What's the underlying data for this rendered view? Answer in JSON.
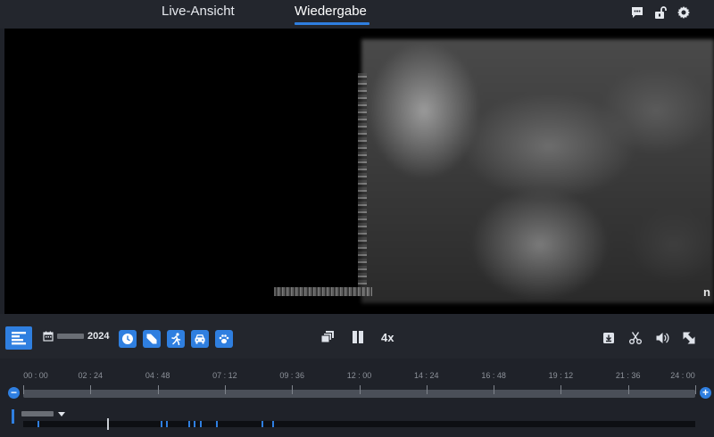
{
  "tabs": {
    "live_label": "Live-Ansicht",
    "playback_label": "Wiedergabe",
    "active": "Wiedergabe"
  },
  "top_icons": [
    "chat-icon",
    "unlock-icon",
    "gear-icon"
  ],
  "video": {
    "osd_text": "n"
  },
  "toolbar": {
    "date_year": "2024",
    "speed_label": "4x",
    "filter_icons": [
      "clock-icon",
      "tag-icon",
      "running-person-icon",
      "car-icon",
      "paw-icon"
    ],
    "center_icons": [
      "multi-window-icon",
      "pause-icon"
    ],
    "right_icons": [
      "download-icon",
      "scissors-icon",
      "volume-icon",
      "fullscreen-icon"
    ]
  },
  "timeline": {
    "ticks": [
      "00 : 00",
      "02 : 24",
      "04 : 48",
      "07 : 12",
      "09 : 36",
      "12 : 00",
      "14 : 24",
      "16 : 48",
      "19 : 12",
      "21 : 36",
      "24 : 00"
    ],
    "zoom_out": "−",
    "zoom_in": "+",
    "recording_hours": [
      0.5,
      4.9,
      5.1,
      5.9,
      6.1,
      6.3,
      6.9,
      8.5,
      8.9
    ],
    "cursor_hour": 3.0
  },
  "colors": {
    "accent": "#2f7fe0",
    "background": "#1f2229",
    "panel": "#23262d"
  }
}
